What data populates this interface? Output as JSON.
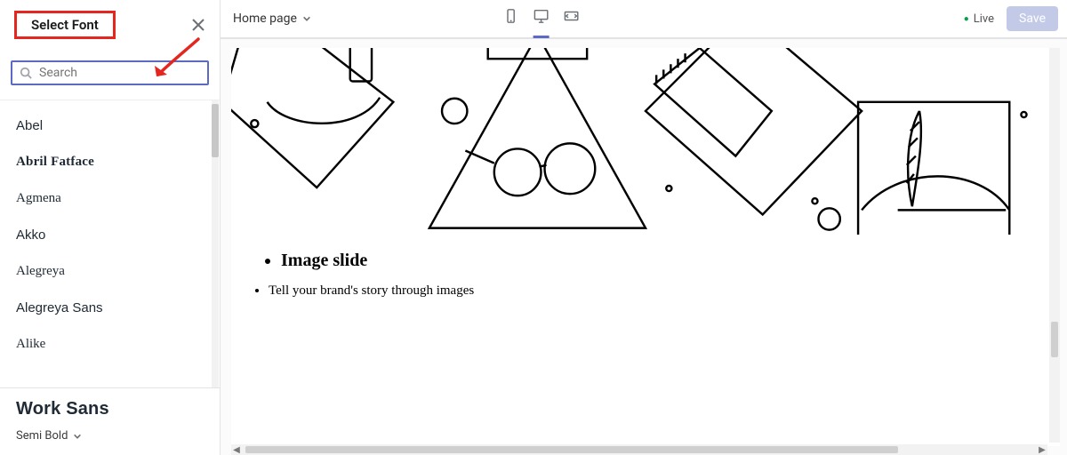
{
  "panel": {
    "title": "Select Font",
    "search_placeholder": "Search",
    "fonts": [
      "Abel",
      "Abril Fatface",
      "Agmena",
      "Akko",
      "Alegreya",
      "Alegreya Sans",
      "Alike"
    ],
    "current_font": "Work Sans",
    "current_weight": "Semi Bold"
  },
  "topbar": {
    "page_label": "Home page",
    "live_label": "Live",
    "save_label": "Save"
  },
  "preview": {
    "heading": "Image slide",
    "bullet": "Tell your brand's story through images"
  }
}
